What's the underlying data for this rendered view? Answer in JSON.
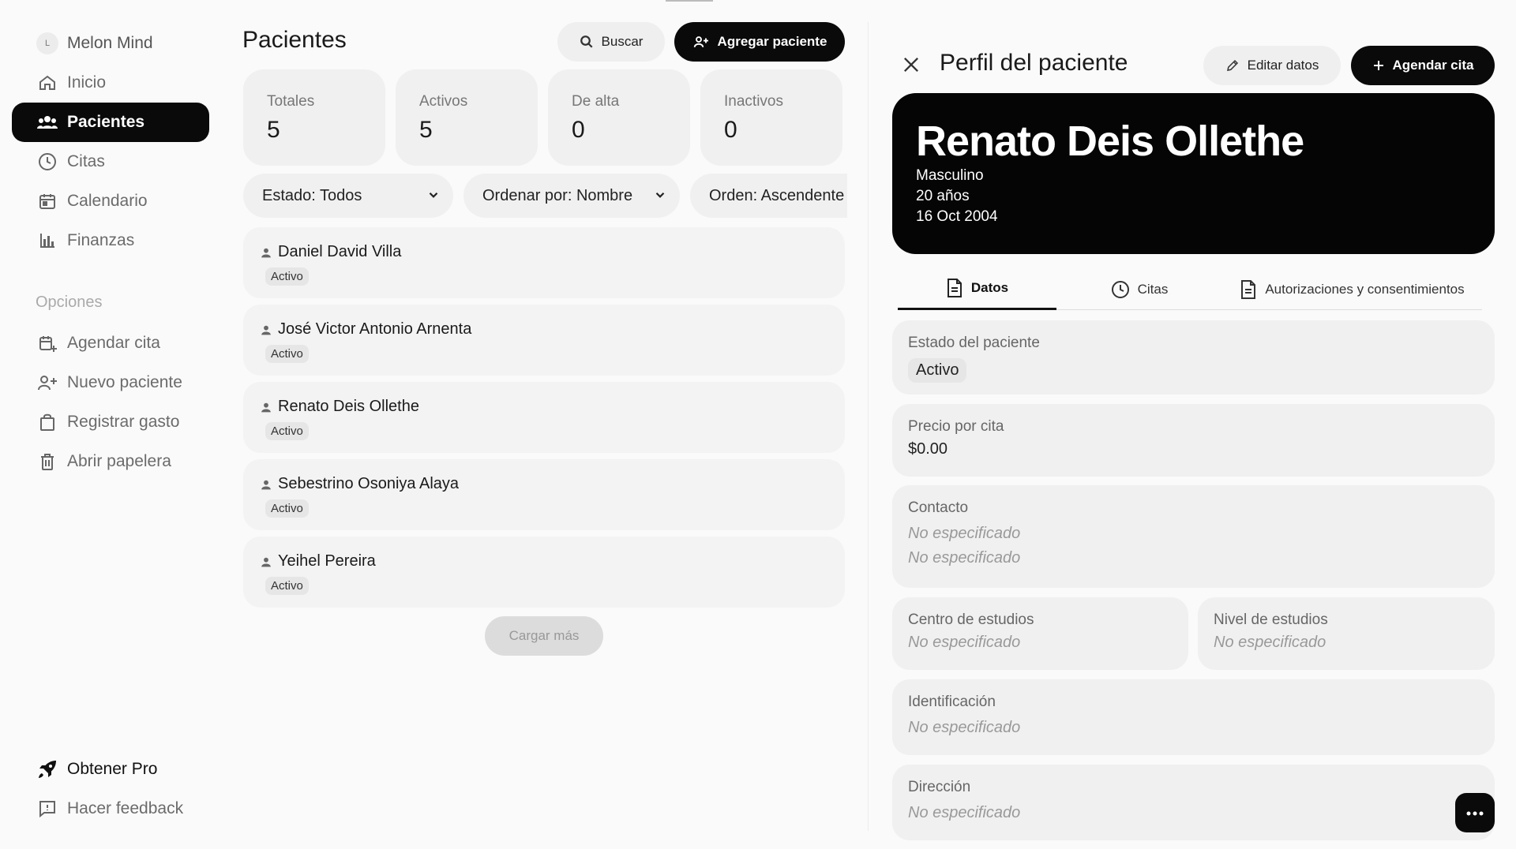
{
  "sidebar": {
    "brand": {
      "initial": "L",
      "name": "Melon Mind"
    },
    "nav": [
      {
        "label": "Inicio",
        "icon": "home-icon"
      },
      {
        "label": "Pacientes",
        "icon": "users-icon",
        "active": true
      },
      {
        "label": "Citas",
        "icon": "clock-icon"
      },
      {
        "label": "Calendario",
        "icon": "calendar-icon"
      },
      {
        "label": "Finanzas",
        "icon": "bar-chart-icon"
      }
    ],
    "options_label": "Opciones",
    "options": [
      {
        "label": "Agendar cita",
        "icon": "calendar-plus-icon"
      },
      {
        "label": "Nuevo paciente",
        "icon": "user-plus-icon"
      },
      {
        "label": "Registrar gasto",
        "icon": "shopping-bag-icon"
      },
      {
        "label": "Abrir papelera",
        "icon": "trash-icon"
      }
    ],
    "footer": [
      {
        "label": "Obtener Pro",
        "icon": "rocket-icon"
      },
      {
        "label": "Hacer feedback",
        "icon": "feedback-icon"
      }
    ]
  },
  "patients": {
    "title": "Pacientes",
    "search_label": "Buscar",
    "add_label": "Agregar paciente",
    "stats": [
      {
        "label": "Totales",
        "value": "5"
      },
      {
        "label": "Activos",
        "value": "5"
      },
      {
        "label": "De alta",
        "value": "0"
      },
      {
        "label": "Inactivos",
        "value": "0"
      }
    ],
    "filters": {
      "estado": "Estado: Todos",
      "ordenar": "Ordenar por: Nombre",
      "orden": "Orden: Ascendente"
    },
    "list": [
      {
        "name": "Daniel David Villa",
        "status": "Activo"
      },
      {
        "name": "José Victor Antonio Arnenta",
        "status": "Activo"
      },
      {
        "name": "Renato Deis Ollethe",
        "status": "Activo"
      },
      {
        "name": "Sebestrino Osoniya Alaya",
        "status": "Activo"
      },
      {
        "name": "Yeihel Pereira",
        "status": "Activo"
      }
    ],
    "load_more": "Cargar más"
  },
  "profile": {
    "title": "Perfil del paciente",
    "edit_label": "Editar datos",
    "schedule_label": "Agendar cita",
    "name": "Renato Deis Ollethe",
    "gender": "Masculino",
    "age": "20 años",
    "birthdate": "16 Oct 2004",
    "tabs": [
      {
        "label": "Datos",
        "active": true
      },
      {
        "label": "Citas"
      },
      {
        "label": "Autorizaciones y consentimientos"
      }
    ],
    "estado": {
      "label": "Estado del paciente",
      "value": "Activo"
    },
    "precio": {
      "label": "Precio por cita",
      "value": "$0.00"
    },
    "contacto": {
      "label": "Contacto",
      "values": [
        "No especificado",
        "No especificado"
      ]
    },
    "centro": {
      "label": "Centro de estudios",
      "value": "No especificado"
    },
    "nivel": {
      "label": "Nivel de estudios",
      "value": "No especificado"
    },
    "identificacion": {
      "label": "Identificación",
      "value": "No especificado"
    },
    "direccion": {
      "label": "Dirección",
      "value": "No especificado"
    }
  },
  "colors": {
    "primary": "#0a0a0a",
    "card": "#f0f0f0",
    "muted": "#6b6b6b"
  }
}
